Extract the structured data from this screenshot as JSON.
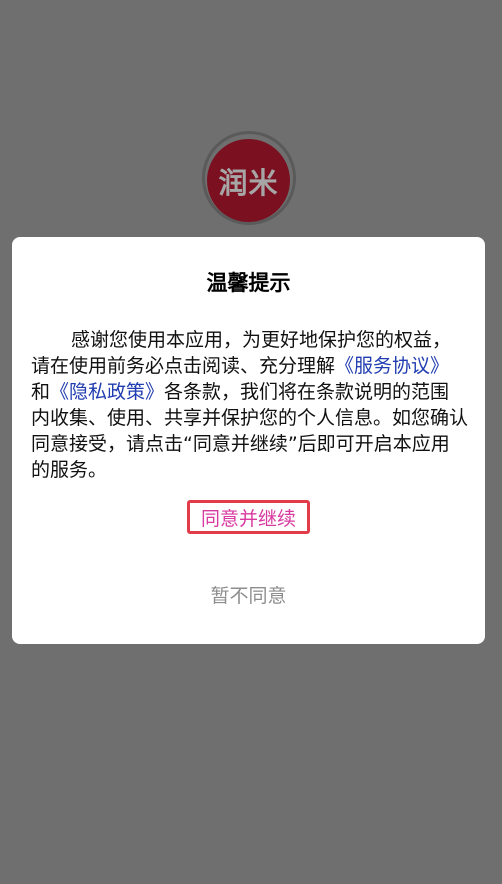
{
  "app": {
    "logo_text": "润米"
  },
  "dialog": {
    "title": "温馨提示",
    "message_part1": "感谢您使用本应用，为更好地保护您的权益，请在使用前务必点击阅读、充分理解",
    "service_agreement_link": "《服务协议》",
    "message_part2": "和",
    "privacy_policy_link": "《隐私政策》",
    "message_part3": "各条款，我们将在条款说明的范围内收集、使用、共享并保护您的个人信息。如您确认同意接受，请点击“同意并继续”后即可开启本应用的服务。",
    "agree_button_label": "同意并继续",
    "disagree_button_label": "暂不同意"
  },
  "colors": {
    "overlay": "#6f6f6f",
    "logo_background": "#7a1020",
    "link": "#1f3cb0",
    "agree_text": "#d93aa0",
    "agree_border": "#e23c4b",
    "disagree_text": "#8d8d8d"
  }
}
